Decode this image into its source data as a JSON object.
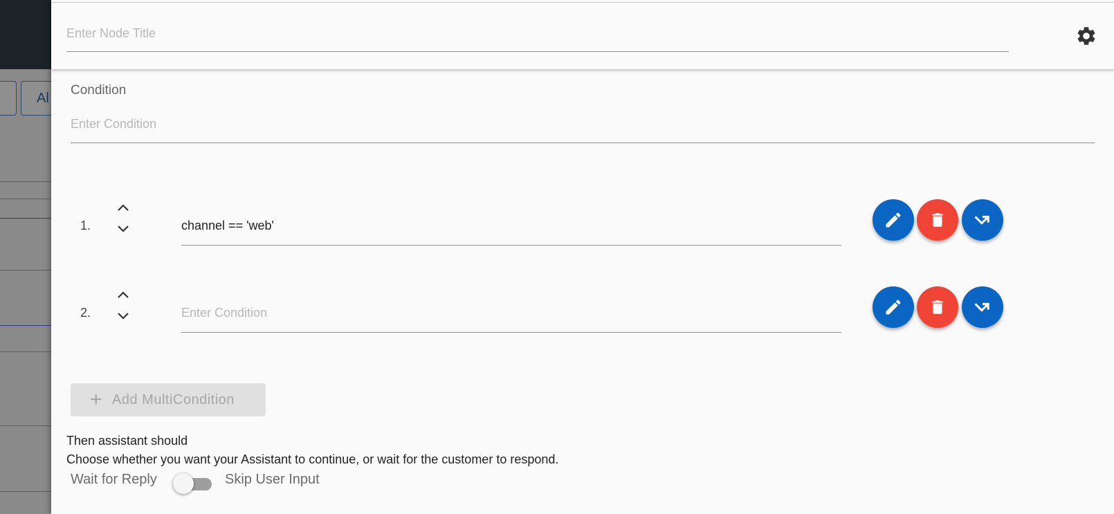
{
  "background": {
    "button_partial_label": "Al"
  },
  "header": {
    "title_placeholder": "Enter Node Title",
    "settings_icon": "gear-icon"
  },
  "condition": {
    "label": "Condition",
    "placeholder": "Enter Condition",
    "value": ""
  },
  "multi_conditions": [
    {
      "number": "1.",
      "value": "channel == 'web'",
      "placeholder": "Enter Condition"
    },
    {
      "number": "2.",
      "value": "",
      "placeholder": "Enter Condition"
    }
  ],
  "row_actions": {
    "edit_icon": "pencil-icon",
    "delete_icon": "trash-icon",
    "jump_icon": "jump-arrow-icon",
    "up_icon": "chevron-up-icon",
    "down_icon": "chevron-down-icon"
  },
  "colors": {
    "primary": "#0b66c3",
    "danger": "#f04436"
  },
  "add_button": {
    "icon": "plus-icon",
    "label": "Add MultiCondition"
  },
  "then": {
    "title": "Then assistant should",
    "description": "Choose whether you want your Assistant to continue, or wait for the customer to respond.",
    "wait_label": "Wait for Reply",
    "skip_label": "Skip User Input",
    "skip_enabled": false
  }
}
